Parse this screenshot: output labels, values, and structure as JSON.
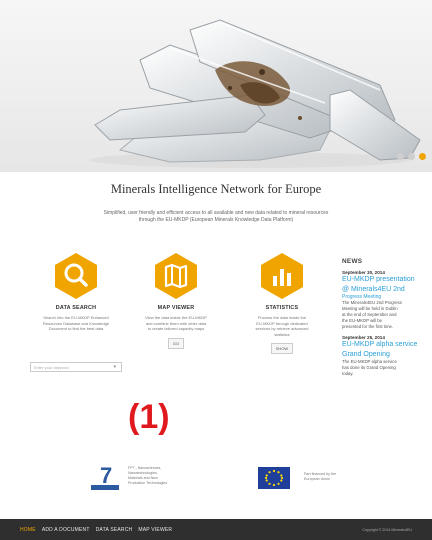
{
  "hero": {
    "slide_count": 3,
    "active_slide": 3
  },
  "site": {
    "title": "Minerals Intelligence Network for Europe",
    "tagline_line1": "Simplified, user friendly and efficient access to all available and new data related to mineral resources",
    "tagline_line2": "through the EU-MKDP (European Minerals Knowledge Data Platform)"
  },
  "features": [
    {
      "title": "DATA SEARCH",
      "desc": [
        "Search into the EU-MKDP Enhanced",
        "Resources Database and Knowledge",
        "Document to find the best data"
      ],
      "search_placeholder": "Enter your keyword"
    },
    {
      "title": "MAP VIEWER",
      "desc": [
        "View the data inside the EU-MKDP",
        "and combine them with other data",
        "to create tailored capacity maps"
      ],
      "button": "GO"
    },
    {
      "title": "STATISTICS",
      "desc": [
        "Process the data inside the",
        "EU-MKDP through dedicated",
        "services by retrieve advanced",
        "statistics"
      ],
      "button": "SHOW"
    }
  ],
  "news": {
    "heading": "NEWS",
    "items": [
      {
        "date": "September 30, 2014",
        "title_lines": [
          "EU-MKDP presentation",
          "@ Minerals4EU 2nd"
        ],
        "subtitle": "Progress Meeting",
        "body": [
          "The Minerals4EU 2nd Progress",
          "Meeting will be held in Dublin",
          "at the end of September and",
          "the EU-MKDP will be",
          "presented for the first time."
        ]
      },
      {
        "date": "September 25, 2014",
        "title_lines": [
          "EU-MKDP alpha service",
          "Grand Opening"
        ],
        "body": [
          "The EU-MKDP alpha service",
          "has done its Grand Opening",
          "today."
        ]
      }
    ]
  },
  "annotation": "(1)",
  "funding": {
    "fp7_text": [
      "FP7 - Nanosciences,",
      "Nanotechnologies,",
      "Materials and New",
      "Production Technologies"
    ],
    "eu_text": [
      "Part financed by the",
      "European Union"
    ]
  },
  "footer": {
    "nav": [
      "HOME",
      "ADD A DOCUMENT",
      "DATA SEARCH",
      "MAP VIEWER"
    ],
    "active_index": 0,
    "copyright": "Copyright © 2014 Minerals4EU"
  },
  "colors": {
    "accent": "#f0a400",
    "news_link": "#2a9fd6",
    "annotation": "#e0191f",
    "footer_bg": "#2f2f2f"
  }
}
